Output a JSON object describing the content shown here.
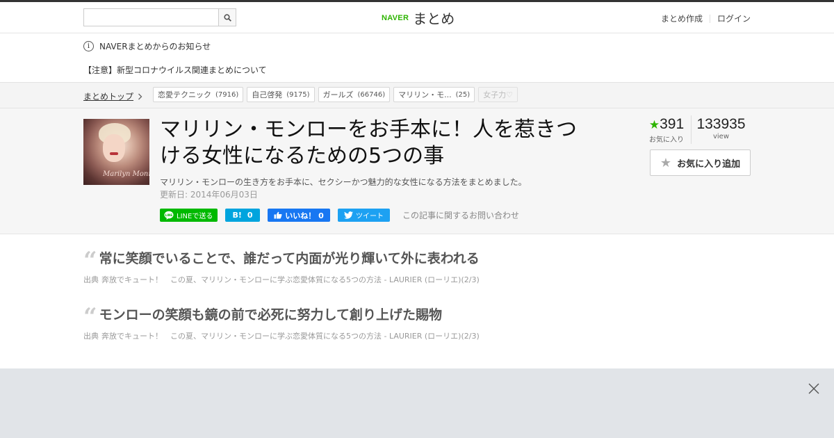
{
  "header": {
    "search_placeholder": "",
    "logo_brand": "NAVER",
    "logo_service": "まとめ",
    "links": [
      "まとめ作成",
      "ログイン"
    ]
  },
  "notice": {
    "info_text": "NAVERまとめからのお知らせ",
    "alert_text": "【注意】新型コロナウイルス関連まとめについて"
  },
  "breadcrumb": {
    "label": "まとめトップ",
    "tags": [
      {
        "label": "恋愛テクニック",
        "count": "(7916)"
      },
      {
        "label": "自己啓発",
        "count": "(9175)"
      },
      {
        "label": "ガールズ",
        "count": "(66746)"
      },
      {
        "label": "マリリン・モ...",
        "count": "(25)"
      },
      {
        "label": "女子力♡",
        "count": ""
      }
    ]
  },
  "article": {
    "thumbnail_signature": "Marilyn Monroe",
    "title": "マリリン・モンローをお手本に！人を惹きつける女性になるための5つの事",
    "description": "マリリン・モンローの生き方をお手本に、セクシーかつ魅力的な女性になる方法をまとめました。",
    "date": "更新日: 2014年06月03日",
    "share": {
      "line": "LINEで送る",
      "hatena_count": "0",
      "facebook": "いいね！ 0",
      "twitter": "ツイート"
    },
    "contact": "この記事に関するお問い合わせ",
    "favorites_count": "391",
    "favorites_label": "お気に入り",
    "views_count": "133935",
    "views_label": "view",
    "fav_button": "お気に入り追加"
  },
  "quotes": [
    {
      "text": "常に笑顔でいることで、誰だって内面が光り輝いて外に表われる",
      "source_label": "出典",
      "source_site": "奔放でキュート！　この夏、マリリン・モンローに学ぶ恋愛体質になる5つの方法 - LAURIER (ローリエ)(2/3)"
    },
    {
      "text": "モンローの笑顔も鏡の前で必死に努力して創り上げた賜物",
      "source_label": "出典",
      "source_site": "奔放でキュート！　この夏、マリリン・モンローに学ぶ恋愛体質になる5つの方法 - LAURIER (ローリエ)(2/3)"
    }
  ],
  "colors": {
    "brand_green": "#2db400",
    "line_green": "#00b900",
    "hatena_blue": "#00a4de",
    "facebook_blue": "#1877f2",
    "twitter_blue": "#1da1f2"
  }
}
